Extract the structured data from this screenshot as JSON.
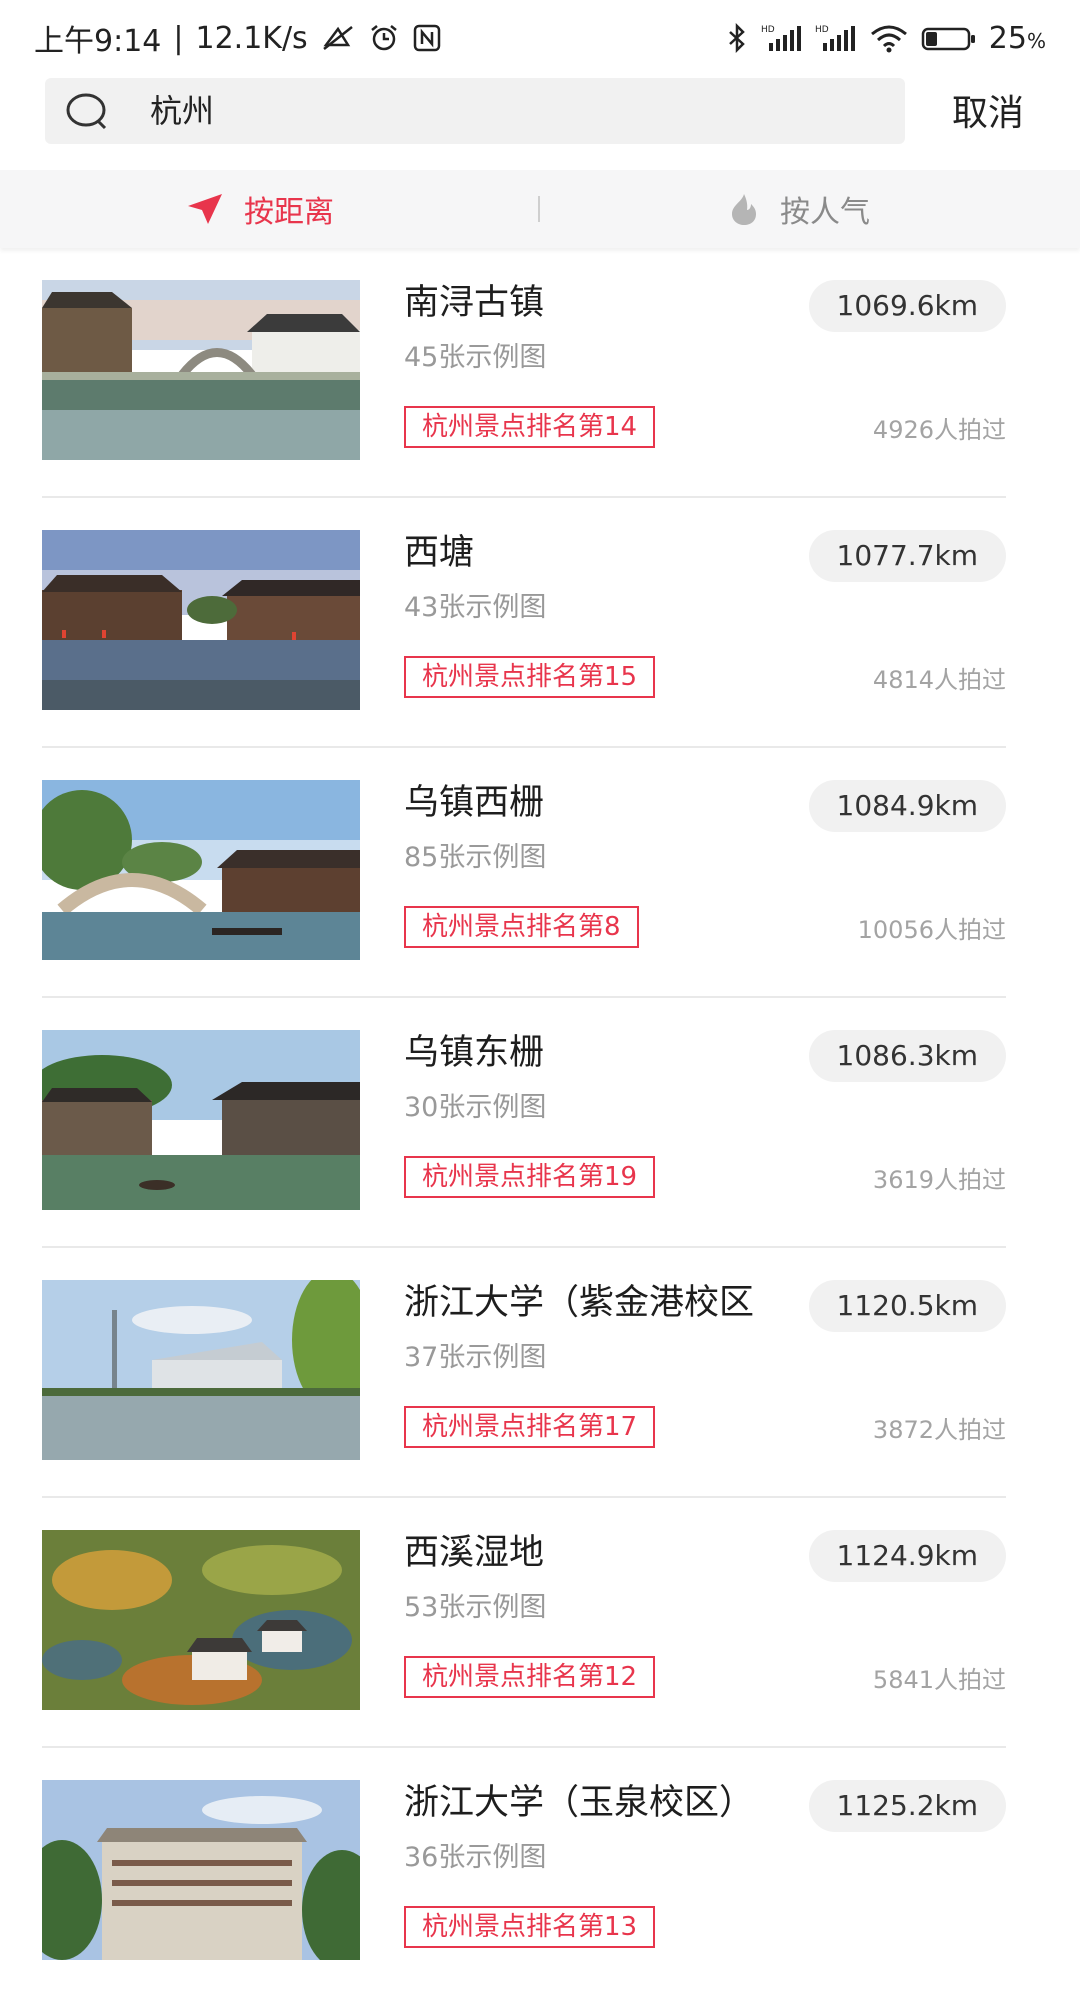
{
  "statusbar": {
    "time": "上午9:14",
    "speed": "12.1K/s",
    "battery": "25",
    "battery_unit": "%",
    "icons": [
      "mute-vibrate-icon",
      "alarm-icon",
      "nfc-icon",
      "bluetooth-icon",
      "signal-hd-icon",
      "signal-hd-icon",
      "wifi-icon",
      "battery-icon"
    ]
  },
  "search": {
    "query": "杭州",
    "cancel_label": "取消"
  },
  "tabs": {
    "distance_label": "按距离",
    "popular_label": "按人气",
    "active": "distance",
    "active_color": "#e8354c"
  },
  "items": [
    {
      "title": "南浔古镇",
      "count": "45张示例图",
      "rank": "杭州景点排名第14",
      "distance": "1069.6km",
      "shots": "4926人拍过"
    },
    {
      "title": "西塘",
      "count": "43张示例图",
      "rank": "杭州景点排名第15",
      "distance": "1077.7km",
      "shots": "4814人拍过"
    },
    {
      "title": "乌镇西栅",
      "count": "85张示例图",
      "rank": "杭州景点排名第8",
      "distance": "1084.9km",
      "shots": "10056人拍过"
    },
    {
      "title": "乌镇东栅",
      "count": "30张示例图",
      "rank": "杭州景点排名第19",
      "distance": "1086.3km",
      "shots": "3619人拍过"
    },
    {
      "title": "浙江大学（紫金港校区",
      "count": "37张示例图",
      "rank": "杭州景点排名第17",
      "distance": "1120.5km",
      "shots": "3872人拍过"
    },
    {
      "title": "西溪湿地",
      "count": "53张示例图",
      "rank": "杭州景点排名第12",
      "distance": "1124.9km",
      "shots": "5841人拍过"
    },
    {
      "title": "浙江大学（玉泉校区）",
      "count": "36张示例图",
      "rank": "杭州景点排名第13",
      "distance": "1125.2km",
      "shots": ""
    }
  ]
}
